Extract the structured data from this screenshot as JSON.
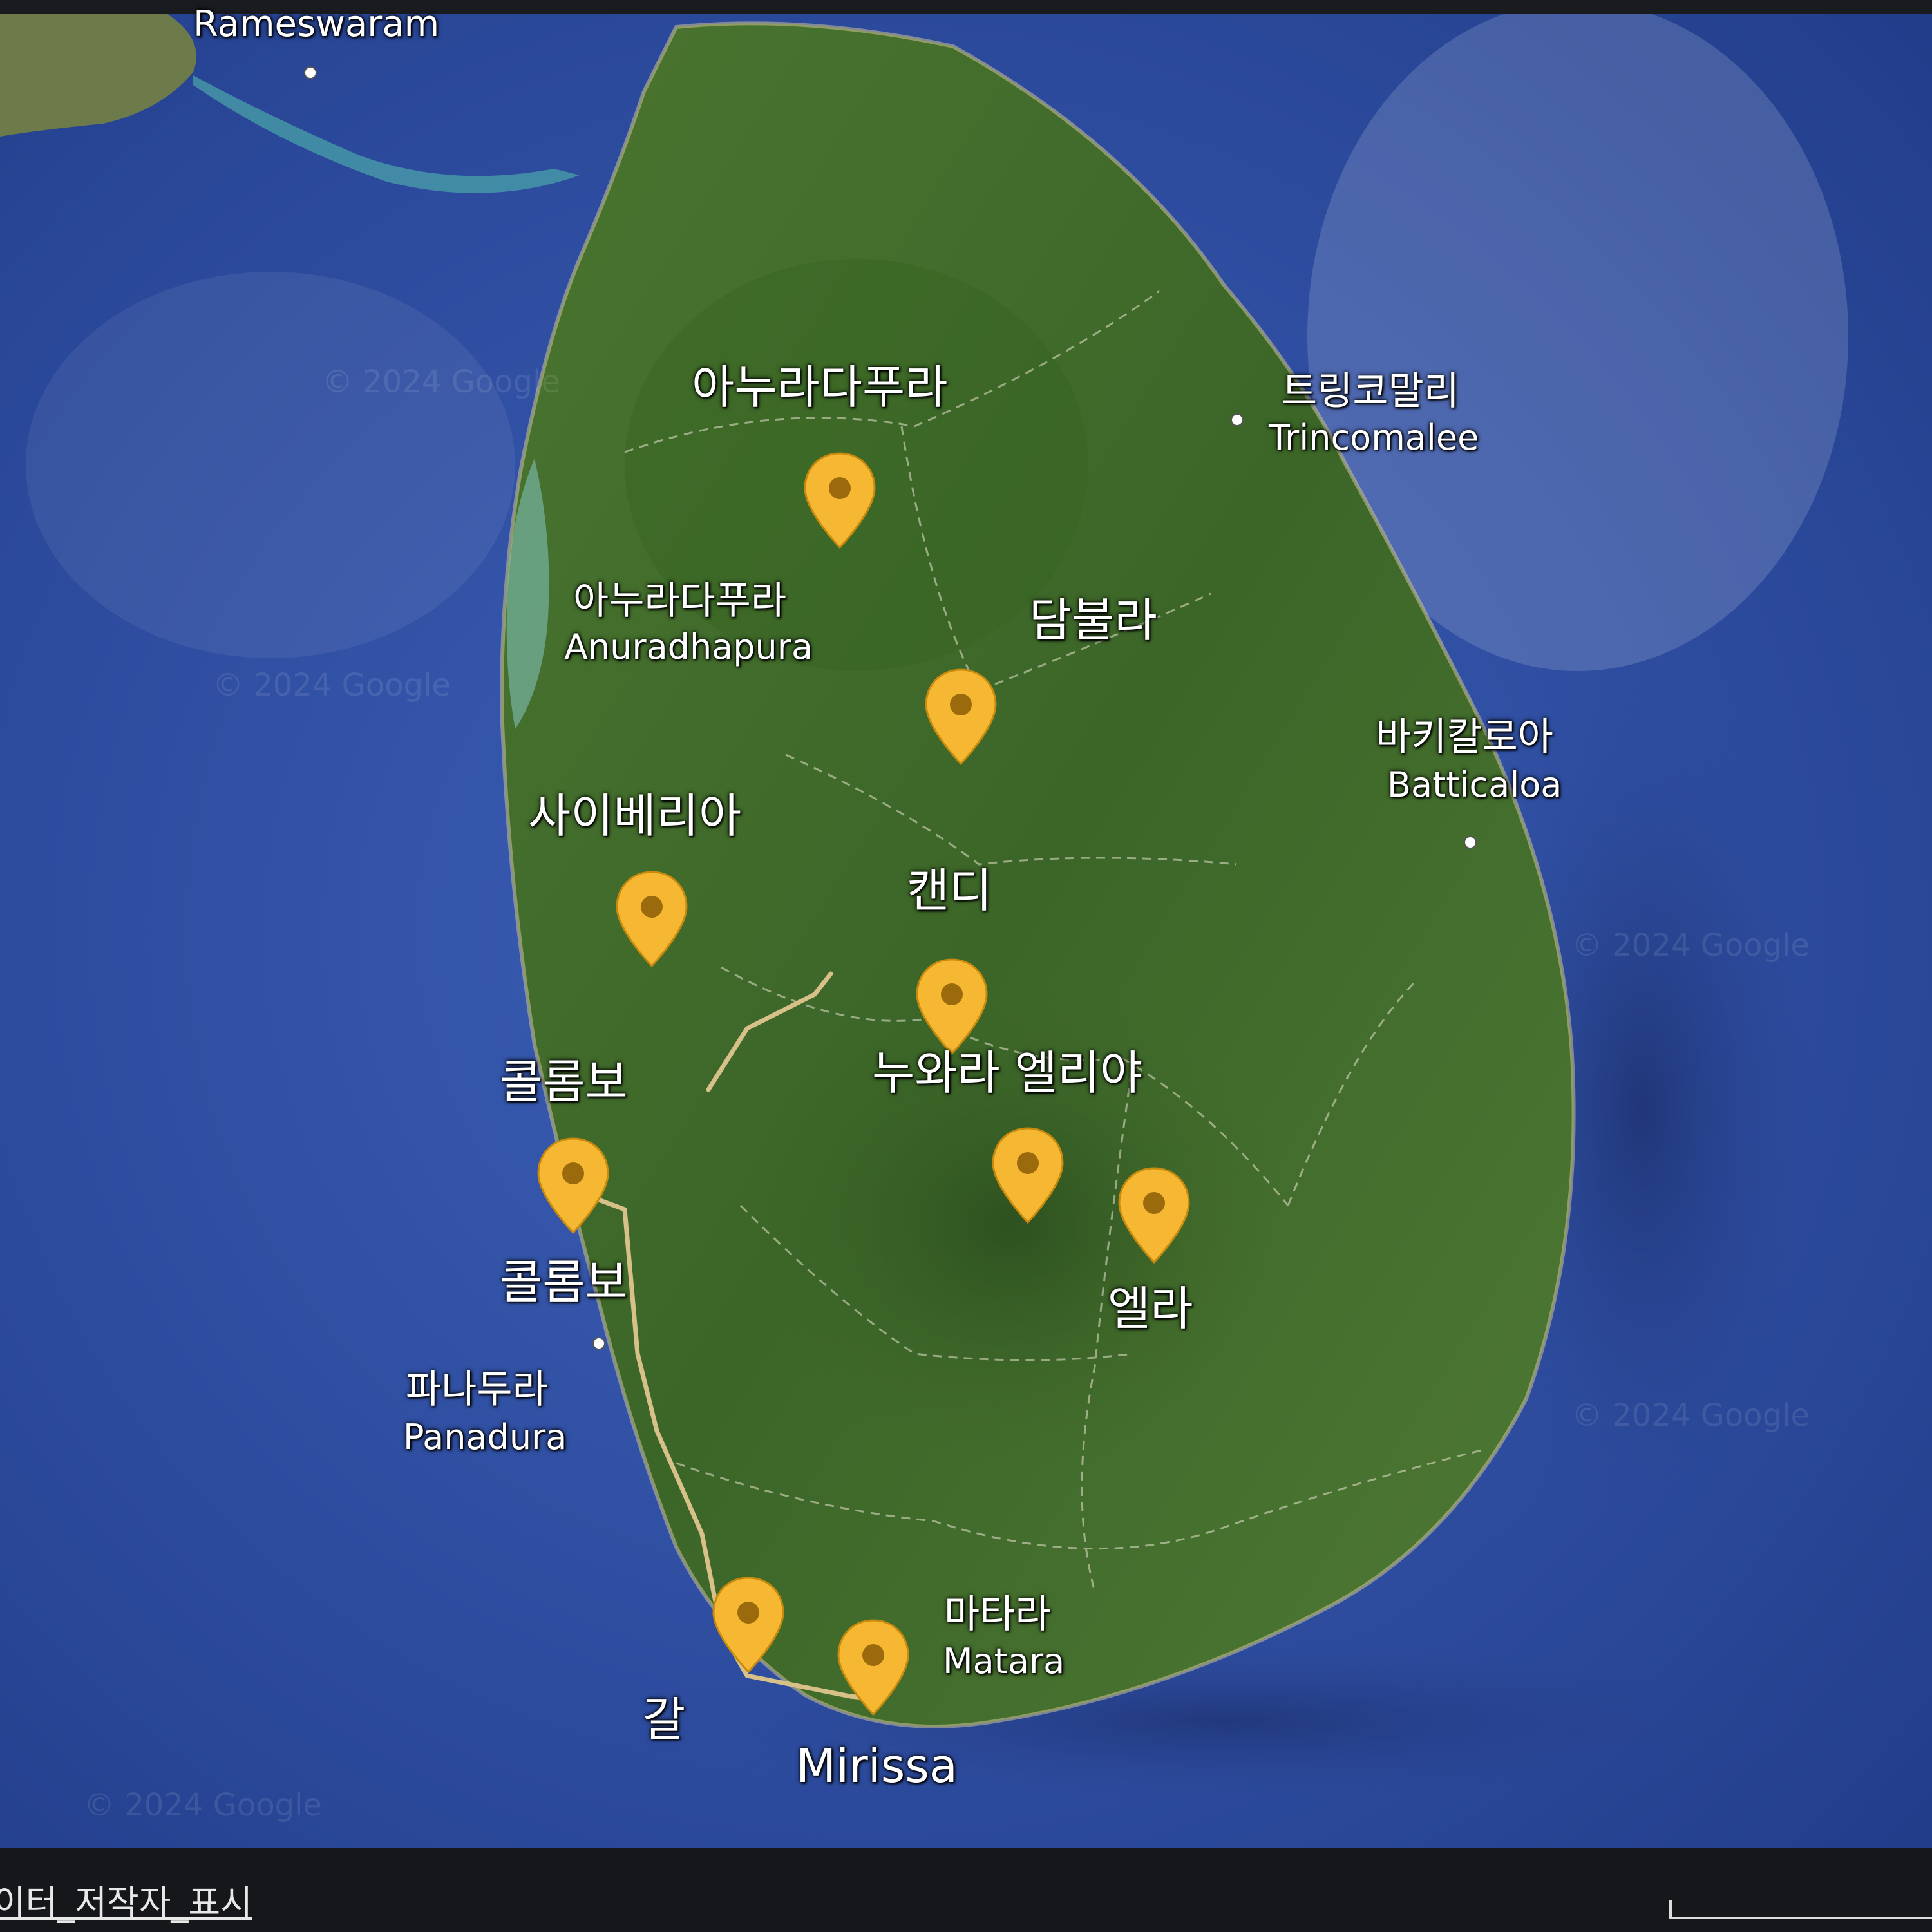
{
  "map": {
    "type": "satellite",
    "ocean_color": "#2f4fa0",
    "land_color": "#3f6a2a",
    "pin_color": "#f6b833",
    "route_color": "#d8c089"
  },
  "labels": {
    "rameswaram": "Rameswaram",
    "anuradhapura_route": "아누라다푸라",
    "anuradhapura_city_ko": "아누라다푸라",
    "anuradhapura_city_en": "Anuradhapura",
    "trincomalee_ko": "트링코말리",
    "trincomalee_en": "Trincomalee",
    "dambulla": "담불라",
    "batticaloa_ko": "바키칼로아",
    "batticaloa_en": "Batticaloa",
    "sigiriya": "사이베리아",
    "kandy": "캔디",
    "nuwara_eliya": "누와라 엘리야",
    "colombo_route": "콜롬보",
    "colombo_city": "콜롬보",
    "ella": "엘라",
    "panadura_ko": "파나두라",
    "panadura_en": "Panadura",
    "matara_ko": "마타라",
    "matara_en": "Matara",
    "galle": "갈",
    "mirissa": "Mirissa"
  },
  "watermark": "© 2024 Google",
  "footer": {
    "attribution": "이터_저작자_표시"
  }
}
